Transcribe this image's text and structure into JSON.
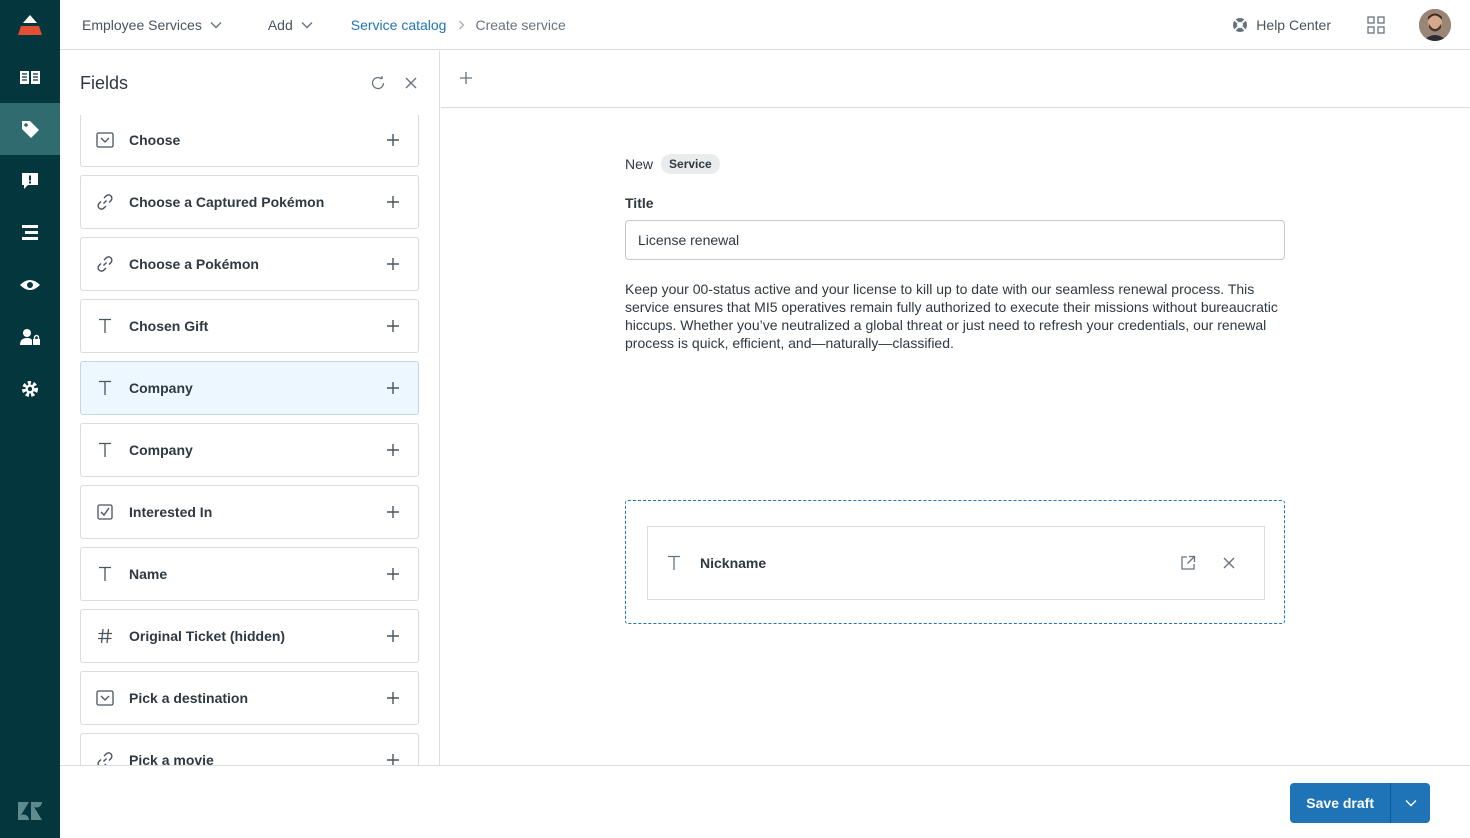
{
  "nav": {
    "items": [
      {
        "id": "knowledge",
        "icon": "book-icon"
      },
      {
        "id": "service-catalog",
        "icon": "tag-icon",
        "active": true
      },
      {
        "id": "alerts",
        "icon": "alert-message-icon"
      },
      {
        "id": "tasks",
        "icon": "stacked-bars-icon"
      },
      {
        "id": "visibility",
        "icon": "eye-icon"
      },
      {
        "id": "user-permissions",
        "icon": "user-lock-icon"
      },
      {
        "id": "settings",
        "icon": "gear-icon"
      }
    ],
    "colors": {
      "background": "#03363d",
      "active": "#2f6b6f",
      "logo_red": "#e34f32"
    }
  },
  "header": {
    "workspace": "Employee Services",
    "add": "Add",
    "breadcrumb": {
      "parent": "Service catalog",
      "current": "Create service"
    },
    "help": "Help Center"
  },
  "fields_panel": {
    "title": "Fields",
    "items": [
      {
        "label": "Choose",
        "icon": "dropdown-icon"
      },
      {
        "label": "Choose a Captured Pokémon",
        "icon": "link-icon"
      },
      {
        "label": "Choose a Pokémon",
        "icon": "link-icon"
      },
      {
        "label": "Chosen Gift",
        "icon": "text-icon"
      },
      {
        "label": "Company",
        "icon": "text-icon",
        "highlighted": true
      },
      {
        "label": "Company",
        "icon": "text-icon"
      },
      {
        "label": "Interested In",
        "icon": "checkbox-icon"
      },
      {
        "label": "Name",
        "icon": "text-icon"
      },
      {
        "label": "Original Ticket (hidden)",
        "icon": "number-icon"
      },
      {
        "label": "Pick a destination",
        "icon": "dropdown-icon"
      },
      {
        "label": "Pick a movie",
        "icon": "link-icon"
      }
    ]
  },
  "editor": {
    "new_label": "New",
    "badge": "Service",
    "title_label": "Title",
    "title_value": "License renewal",
    "description": "Keep your 00-status active and your license to kill up to date with our seamless renewal process. This service ensures that MI5 operatives remain fully authorized to execute their missions without bureaucratic hiccups. Whether you’ve neutralized a global threat or just need to refresh your credentials, our renewal process is quick, efficient, and—naturally—classified.",
    "added_field": {
      "label": "Nickname",
      "icon": "text-icon"
    }
  },
  "footer": {
    "save_label": "Save draft",
    "accent": "#1f73b7"
  }
}
